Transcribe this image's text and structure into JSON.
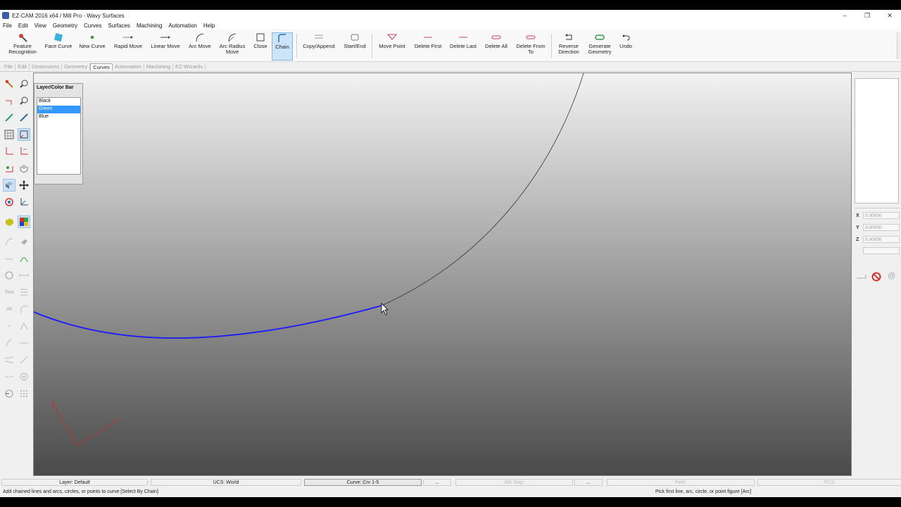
{
  "window": {
    "title": "EZ-CAM 2016 x64 / Mill Pro  - Wavy Surfaces"
  },
  "menu": [
    "File",
    "Edit",
    "View",
    "Geometry",
    "Curves",
    "Surfaces",
    "Machining",
    "Automation",
    "Help"
  ],
  "ribbon": [
    {
      "label": "Feature Recognition",
      "icon": "feature-recognition-icon"
    },
    {
      "label": "Face Curve",
      "icon": "face-curve-icon"
    },
    {
      "label": "New Curve",
      "icon": "new-curve-icon"
    },
    {
      "label": "Rapid Move",
      "icon": "rapid-move-icon"
    },
    {
      "label": "Linear Move",
      "icon": "linear-move-icon"
    },
    {
      "label": "Arc Move",
      "icon": "arc-move-icon"
    },
    {
      "label": "Arc Radius Move",
      "icon": "arc-radius-move-icon"
    },
    {
      "label": "Close",
      "icon": "close-curve-icon"
    },
    {
      "label": "Chain",
      "icon": "chain-icon",
      "active": true
    },
    {
      "label": "Copy/Append",
      "icon": "copy-append-icon"
    },
    {
      "label": "Start/End",
      "icon": "start-end-icon"
    },
    {
      "label": "Move Point",
      "icon": "move-point-icon"
    },
    {
      "label": "Delete First",
      "icon": "delete-first-icon"
    },
    {
      "label": "Delete Last",
      "icon": "delete-last-icon"
    },
    {
      "label": "Delete All",
      "icon": "delete-all-icon"
    },
    {
      "label": "Delete From To",
      "icon": "delete-from-to-icon"
    },
    {
      "label": "Reverse Direction",
      "icon": "reverse-direction-icon"
    },
    {
      "label": "Generate Geometry",
      "icon": "generate-geometry-icon"
    },
    {
      "label": "Undo",
      "icon": "undo-icon"
    }
  ],
  "tabs": [
    {
      "label": "File"
    },
    {
      "label": "Edit"
    },
    {
      "label": "Dimensions"
    },
    {
      "label": "Geometry"
    },
    {
      "label": "Curves",
      "active": true
    },
    {
      "label": "Automation"
    },
    {
      "label": "Machining"
    },
    {
      "label": "EZ-Wizards"
    }
  ],
  "left_tools": {
    "text_label": "Text",
    "all_label": "All"
  },
  "layer_bar": {
    "title": "Layer/Color Bar",
    "items": [
      {
        "label": "Black"
      },
      {
        "label": "Green",
        "selected": true
      },
      {
        "label": "Blue"
      }
    ]
  },
  "coords": {
    "x_label": "X",
    "x_value": "0.00000",
    "y_label": "Y",
    "y_value": "0.00000",
    "z_label": "Z",
    "z_value": "0.00000"
  },
  "status": {
    "layer": "Layer: Default",
    "ucs": "UCS: World",
    "curve": "Curve: Crv 1-5",
    "more1": "...",
    "wa_step": "WA Step:",
    "more2": "...",
    "path": "Path:",
    "pcs": "PCS:"
  },
  "messages": {
    "left": "Add chained lines and arcs, circles, or points to curve [Select By Chain]",
    "right": "Pick first line, arc, circle, or point figure [Arc]"
  },
  "colors": {
    "chain_curve": "#1a1aff",
    "arc_curve": "#333333",
    "axis_triad": "#c03030",
    "selection": "#3399ff"
  }
}
